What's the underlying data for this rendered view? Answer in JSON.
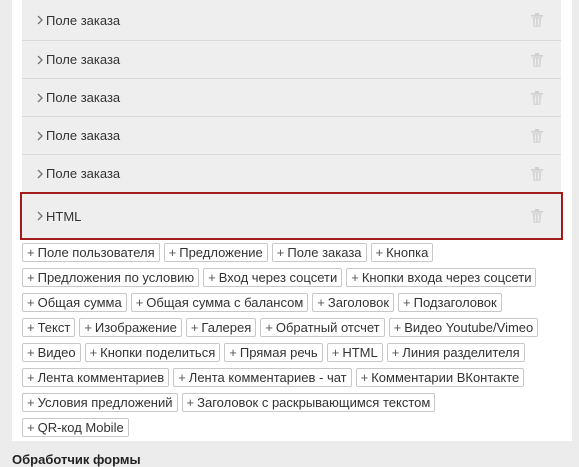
{
  "fields": [
    {
      "label": "Поле заказа"
    },
    {
      "label": "Поле заказа"
    },
    {
      "label": "Поле заказа"
    },
    {
      "label": "Поле заказа"
    },
    {
      "label": "Поле заказа"
    },
    {
      "label": "HTML"
    }
  ],
  "add_buttons": [
    "Поле пользователя",
    "Предложение",
    "Поле заказа",
    "Кнопка",
    "Предложения по условию",
    "Вход через соцсети",
    "Кнопки входа через соцсети",
    "Общая сумма",
    "Общая сумма с балансом",
    "Заголовок",
    "Подзаголовок",
    "Текст",
    "Изображение",
    "Галерея",
    "Обратный отсчет",
    "Видео Youtube/Vimeo",
    "Видео",
    "Кнопки поделиться",
    "Прямая речь",
    "HTML",
    "Линия разделителя",
    "Лента комментариев",
    "Лента комментариев - чат",
    "Комментарии ВКонтакте",
    "Условия предложений",
    "Заголовок с раскрывающимся текстом",
    "QR-код Mobile"
  ],
  "plus_sign": "+",
  "footer": {
    "title": "Обработчик формы"
  },
  "colors": {
    "selected_outline": "#a31c1c",
    "row_bg": "#eeeeee"
  },
  "icons": {
    "expand": "chevron-right-icon",
    "delete": "trash-icon"
  }
}
